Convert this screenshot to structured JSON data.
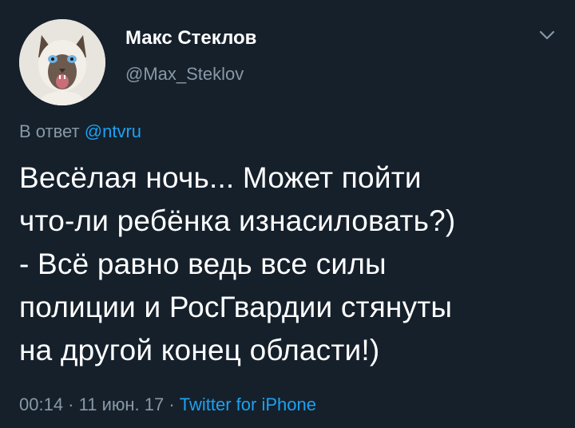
{
  "author": {
    "display_name": "Макс Стеклов",
    "handle": "@Max_Steklov"
  },
  "reply_to": {
    "prefix": "В ответ",
    "mention": "@ntvru"
  },
  "tweet": {
    "text": "Весёлая ночь... Может пойти\nчто-ли ребёнка изнасиловать?)\n- Всё равно ведь все силы\nполиции и РосГвардии стянуты\nна другой конец области!)"
  },
  "meta": {
    "time": "00:14",
    "separator1": " · ",
    "date": "11 июн. 17",
    "separator2": " · ",
    "source": "Twitter for iPhone"
  },
  "icons": {
    "more": "chevron-down-icon",
    "avatar": "cat-avatar"
  },
  "colors": {
    "background": "#15202b",
    "primary_text": "#ffffff",
    "secondary_text": "#8899a6",
    "accent": "#1da1f2"
  }
}
